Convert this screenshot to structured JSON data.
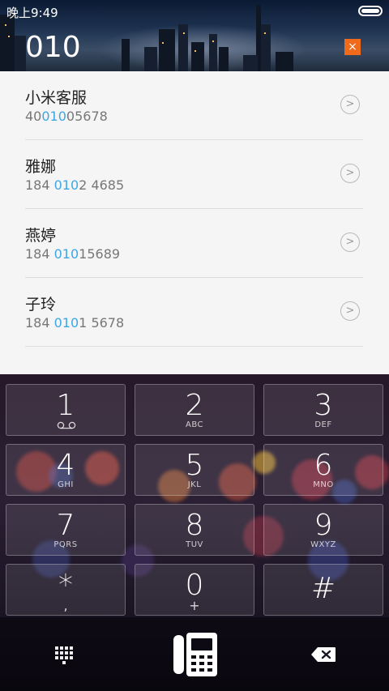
{
  "status": {
    "time": "晚上9:49"
  },
  "dialer": {
    "input": "010",
    "clear_label": "×"
  },
  "results": [
    {
      "name": "小米客服",
      "pre": "40",
      "match": "010",
      "post": "05678"
    },
    {
      "name": "雅娜",
      "pre": "184 ",
      "match": "010",
      "post": "2 4685"
    },
    {
      "name": "燕婷",
      "pre": "184 ",
      "match": "010",
      "post": "15689"
    },
    {
      "name": "子玲",
      "pre": "184 ",
      "match": "010",
      "post": "1 5678"
    }
  ],
  "keys": [
    {
      "digit": "1",
      "letters": "",
      "icon": "voicemail-icon"
    },
    {
      "digit": "2",
      "letters": "ABC"
    },
    {
      "digit": "3",
      "letters": "DEF"
    },
    {
      "digit": "4",
      "letters": "GHI"
    },
    {
      "digit": "5",
      "letters": "JKL"
    },
    {
      "digit": "6",
      "letters": "MNO"
    },
    {
      "digit": "7",
      "letters": "PQRS"
    },
    {
      "digit": "8",
      "letters": "TUV"
    },
    {
      "digit": "9",
      "letters": "WXYZ"
    },
    {
      "digit": "*",
      "letters": ",",
      "sub": true
    },
    {
      "digit": "0",
      "letters": "+",
      "sub": true
    },
    {
      "digit": "#",
      "letters": ""
    }
  ],
  "colors": {
    "accent": "#3ba7e5",
    "clear": "#ef6a1a"
  },
  "icons": {
    "keypad": "keypad-grid-icon",
    "call": "call-phone-icon",
    "delete": "backspace-icon"
  }
}
